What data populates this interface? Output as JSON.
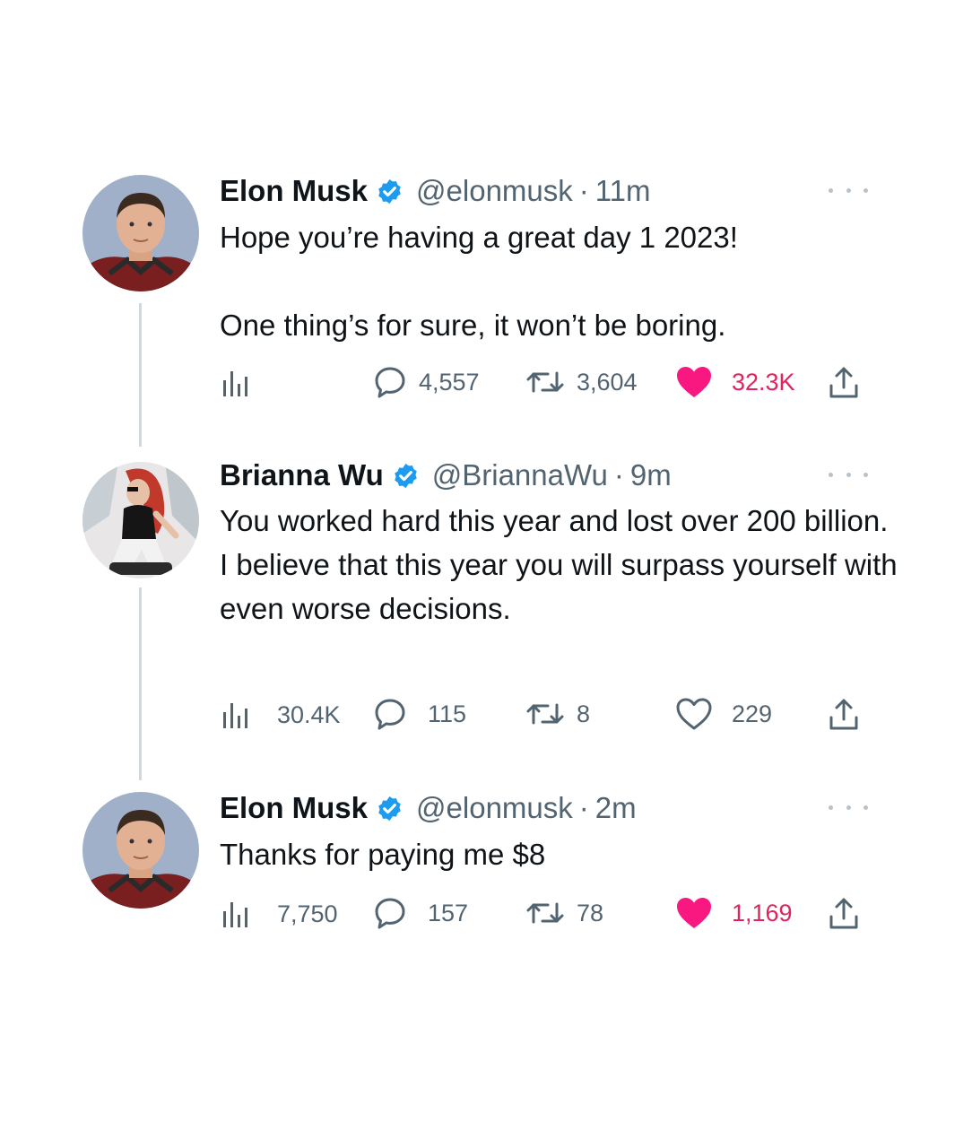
{
  "tweets": [
    {
      "name": "Elon Musk",
      "handle": "@elonmusk",
      "dot": "·",
      "time": "11m",
      "paragraphs": [
        "Hope you’re having a great day 1 2023!",
        "One thing’s for sure, it won’t be boring."
      ],
      "views": "",
      "replies": "4,557",
      "retweets": "3,604",
      "likes": "32.3K",
      "liked": true
    },
    {
      "name": "Brianna Wu",
      "handle": "@BriannaWu",
      "dot": "·",
      "time": "9m",
      "paragraphs": [
        "You worked hard this year and lost over 200 billion. I believe that this year you will surpass yourself with even worse decisions."
      ],
      "views": "30.4K",
      "replies": "115",
      "retweets": "8",
      "likes": "229",
      "liked": false
    },
    {
      "name": "Elon Musk",
      "handle": "@elonmusk",
      "dot": "·",
      "time": "2m",
      "paragraphs": [
        "Thanks for paying me $8"
      ],
      "views": "7,750",
      "replies": "157",
      "retweets": "78",
      "likes": "1,169",
      "liked": true
    }
  ],
  "icons": {
    "verified": "verified-badge-icon",
    "more": "more-icon",
    "views": "views-icon",
    "reply": "reply-icon",
    "retweet": "retweet-icon",
    "like": "heart-icon",
    "share": "share-icon"
  },
  "colors": {
    "verified": "#1d9bf0",
    "like": "#f91880",
    "like_text": "#e0245e",
    "secondary_text": "#536471",
    "thread_line": "#cfd9de"
  }
}
